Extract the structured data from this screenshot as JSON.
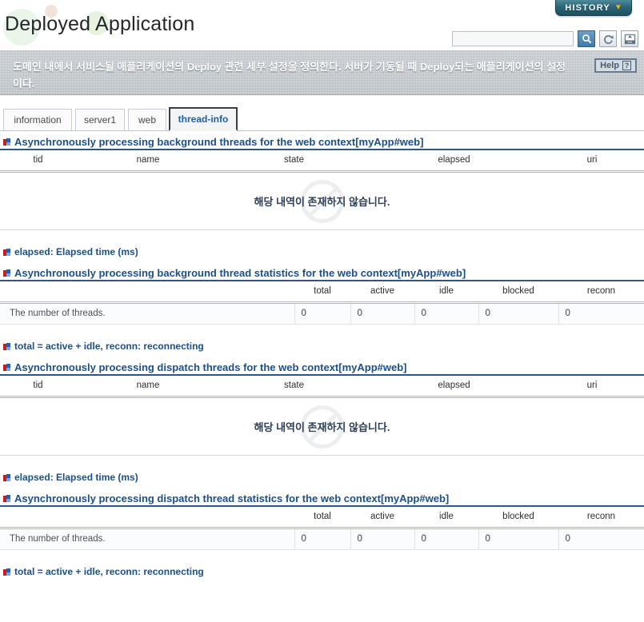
{
  "window": {
    "title": "Deployed Application"
  },
  "history": {
    "label": "HISTORY",
    "chevron": "chevron-down-icon"
  },
  "search": {
    "value": "",
    "placeholder": "",
    "buttons": [
      {
        "name": "search-icon",
        "title": "Search"
      },
      {
        "name": "refresh-icon",
        "title": "Refresh"
      },
      {
        "name": "xml-export-icon",
        "title": "Export XML"
      }
    ]
  },
  "description": {
    "text": "도메인 내에서 서비스될 애플리케이션의 Deploy 관련 세부 설정을 정의한다. 서버가 기동될 때 Deploy되는 애플리케이션의 설정이다.",
    "help_label": "Help",
    "help_mark": "?"
  },
  "tabs": [
    {
      "label": "information",
      "active": false
    },
    {
      "label": "server1",
      "active": false
    },
    {
      "label": "web",
      "active": false
    },
    {
      "label": "thread-info",
      "active": true
    }
  ],
  "sections": {
    "background_threads": {
      "heading": "Asynchronously processing background threads for the web context[myApp#web]",
      "columns": [
        "tid",
        "name",
        "state",
        "elapsed",
        "uri"
      ],
      "empty_message": "해당 내역이 존재하지 않습니다.",
      "note": "elapsed: Elapsed time (ms)"
    },
    "background_stats": {
      "heading": "Asynchronously processing background thread statistics for the web context[myApp#web]",
      "columns": [
        "",
        "total",
        "active",
        "idle",
        "blocked",
        "reconn"
      ],
      "rows": [
        {
          "label": "The number of threads.",
          "total": "0",
          "active": "0",
          "idle": "0",
          "blocked": "0",
          "reconn": "0"
        }
      ],
      "note": "total = active + idle, reconn: reconnecting"
    },
    "dispatch_threads": {
      "heading": "Asynchronously processing dispatch threads for the web context[myApp#web]",
      "columns": [
        "tid",
        "name",
        "state",
        "elapsed",
        "uri"
      ],
      "empty_message": "해당 내역이 존재하지 않습니다.",
      "note": "elapsed: Elapsed time (ms)"
    },
    "dispatch_stats": {
      "heading": "Asynchronously processing dispatch thread statistics for the web context[myApp#web]",
      "columns": [
        "",
        "total",
        "active",
        "idle",
        "blocked",
        "reconn"
      ],
      "rows": [
        {
          "label": "The number of threads.",
          "total": "0",
          "active": "0",
          "idle": "0",
          "blocked": "0",
          "reconn": "0"
        }
      ],
      "note": "total = active + idle, reconn: reconnecting"
    }
  },
  "colors": {
    "heading_blue": "#1b4f8a",
    "tab_active_text": "#1f5fa8",
    "history_teal": "#2b6677",
    "history_chevron": "#f4b31e",
    "banner_grey": "#acb6bf"
  }
}
